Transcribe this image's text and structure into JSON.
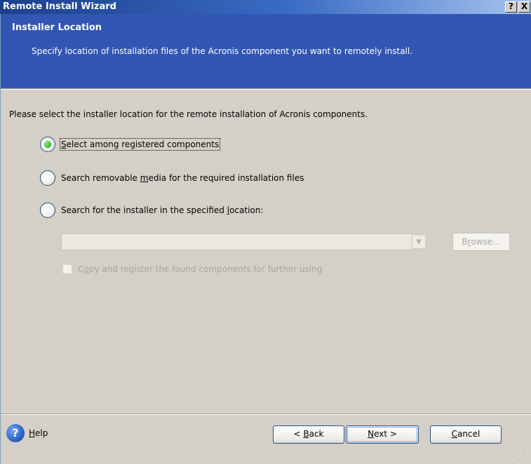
{
  "window": {
    "title": "Remote Install Wizard",
    "help_glyph": "?",
    "close_glyph": "X"
  },
  "header": {
    "title": "Installer Location",
    "subtitle": "Specify location of installation files of the Acronis component you want to remotely install."
  },
  "body": {
    "prompt": "Please select the installer location for the remote installation of Acronis components.",
    "options": [
      {
        "pre": "",
        "mnemonic": "S",
        "post": "elect among registered components",
        "checked": true
      },
      {
        "pre": "Search removable ",
        "mnemonic": "m",
        "post": "edia for the required installation files",
        "checked": false
      },
      {
        "pre": "Search for the installer in the specified ",
        "mnemonic": "l",
        "post": "ocation:",
        "checked": false
      }
    ],
    "location_combo": {
      "value": "",
      "enabled": false
    },
    "browse": {
      "pre": "B",
      "mnemonic": "r",
      "post": "owse...",
      "enabled": false
    },
    "copy_checkbox": {
      "pre": "C",
      "mnemonic": "o",
      "post": "py and register the found components for further using",
      "checked": false,
      "enabled": false
    }
  },
  "footer": {
    "help": {
      "pre": "",
      "mnemonic": "H",
      "post": "elp"
    },
    "back": {
      "pre": "< ",
      "mnemonic": "B",
      "post": "ack"
    },
    "next": {
      "pre": "",
      "mnemonic": "N",
      "post": "ext >"
    },
    "cancel": {
      "pre": "",
      "mnemonic": "C",
      "post": "ancel"
    }
  },
  "colors": {
    "header_blue": "#3156b4",
    "dialog_gray": "#d4d0c8",
    "radio_selected": "#2fb024",
    "disabled_text": "#a8a59a"
  }
}
